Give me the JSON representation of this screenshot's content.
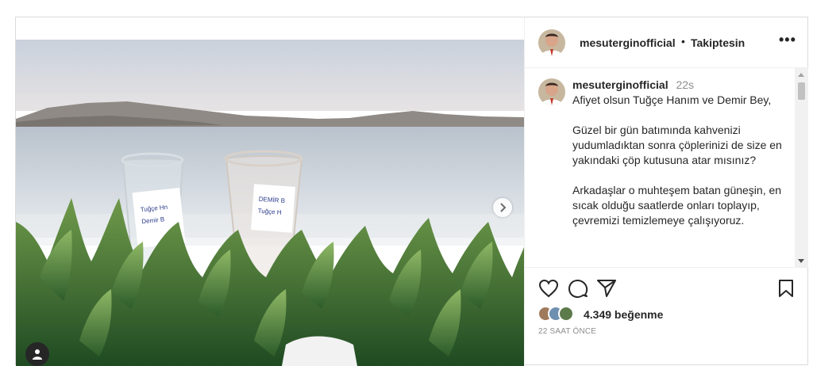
{
  "post": {
    "username": "mesuterginofficial",
    "separator": "•",
    "follow_status": "Takiptesin",
    "more_label": "•••"
  },
  "caption": {
    "username": "mesuterginofficial",
    "time_ago": "22s",
    "paragraphs": [
      "Afiyet olsun Tuğçe Hanım ve Demir Bey,",
      "Güzel bir gün batımında kahvenizi yudumladıktan sonra çöplerinizi de size en yakındaki çöp kutusuna atar mısınız?",
      "Arkadaşlar o muhteşem batan güneşin, en sıcak olduğu saatlerde onları toplayıp, çevremizi temizlemeye çalışıyoruz."
    ]
  },
  "engagement": {
    "likes": "4.349 beğenme",
    "timestamp": "22 SAAT ÖNCE"
  },
  "icons": {
    "like": "heart-icon",
    "comment": "comment-icon",
    "share": "paper-plane-icon",
    "save": "bookmark-icon",
    "next": "chevron-right-icon",
    "tag": "user-tag-icon"
  },
  "colors": {
    "text": "#262626",
    "muted": "#8e8e8e",
    "border": "#dbdbdb"
  }
}
